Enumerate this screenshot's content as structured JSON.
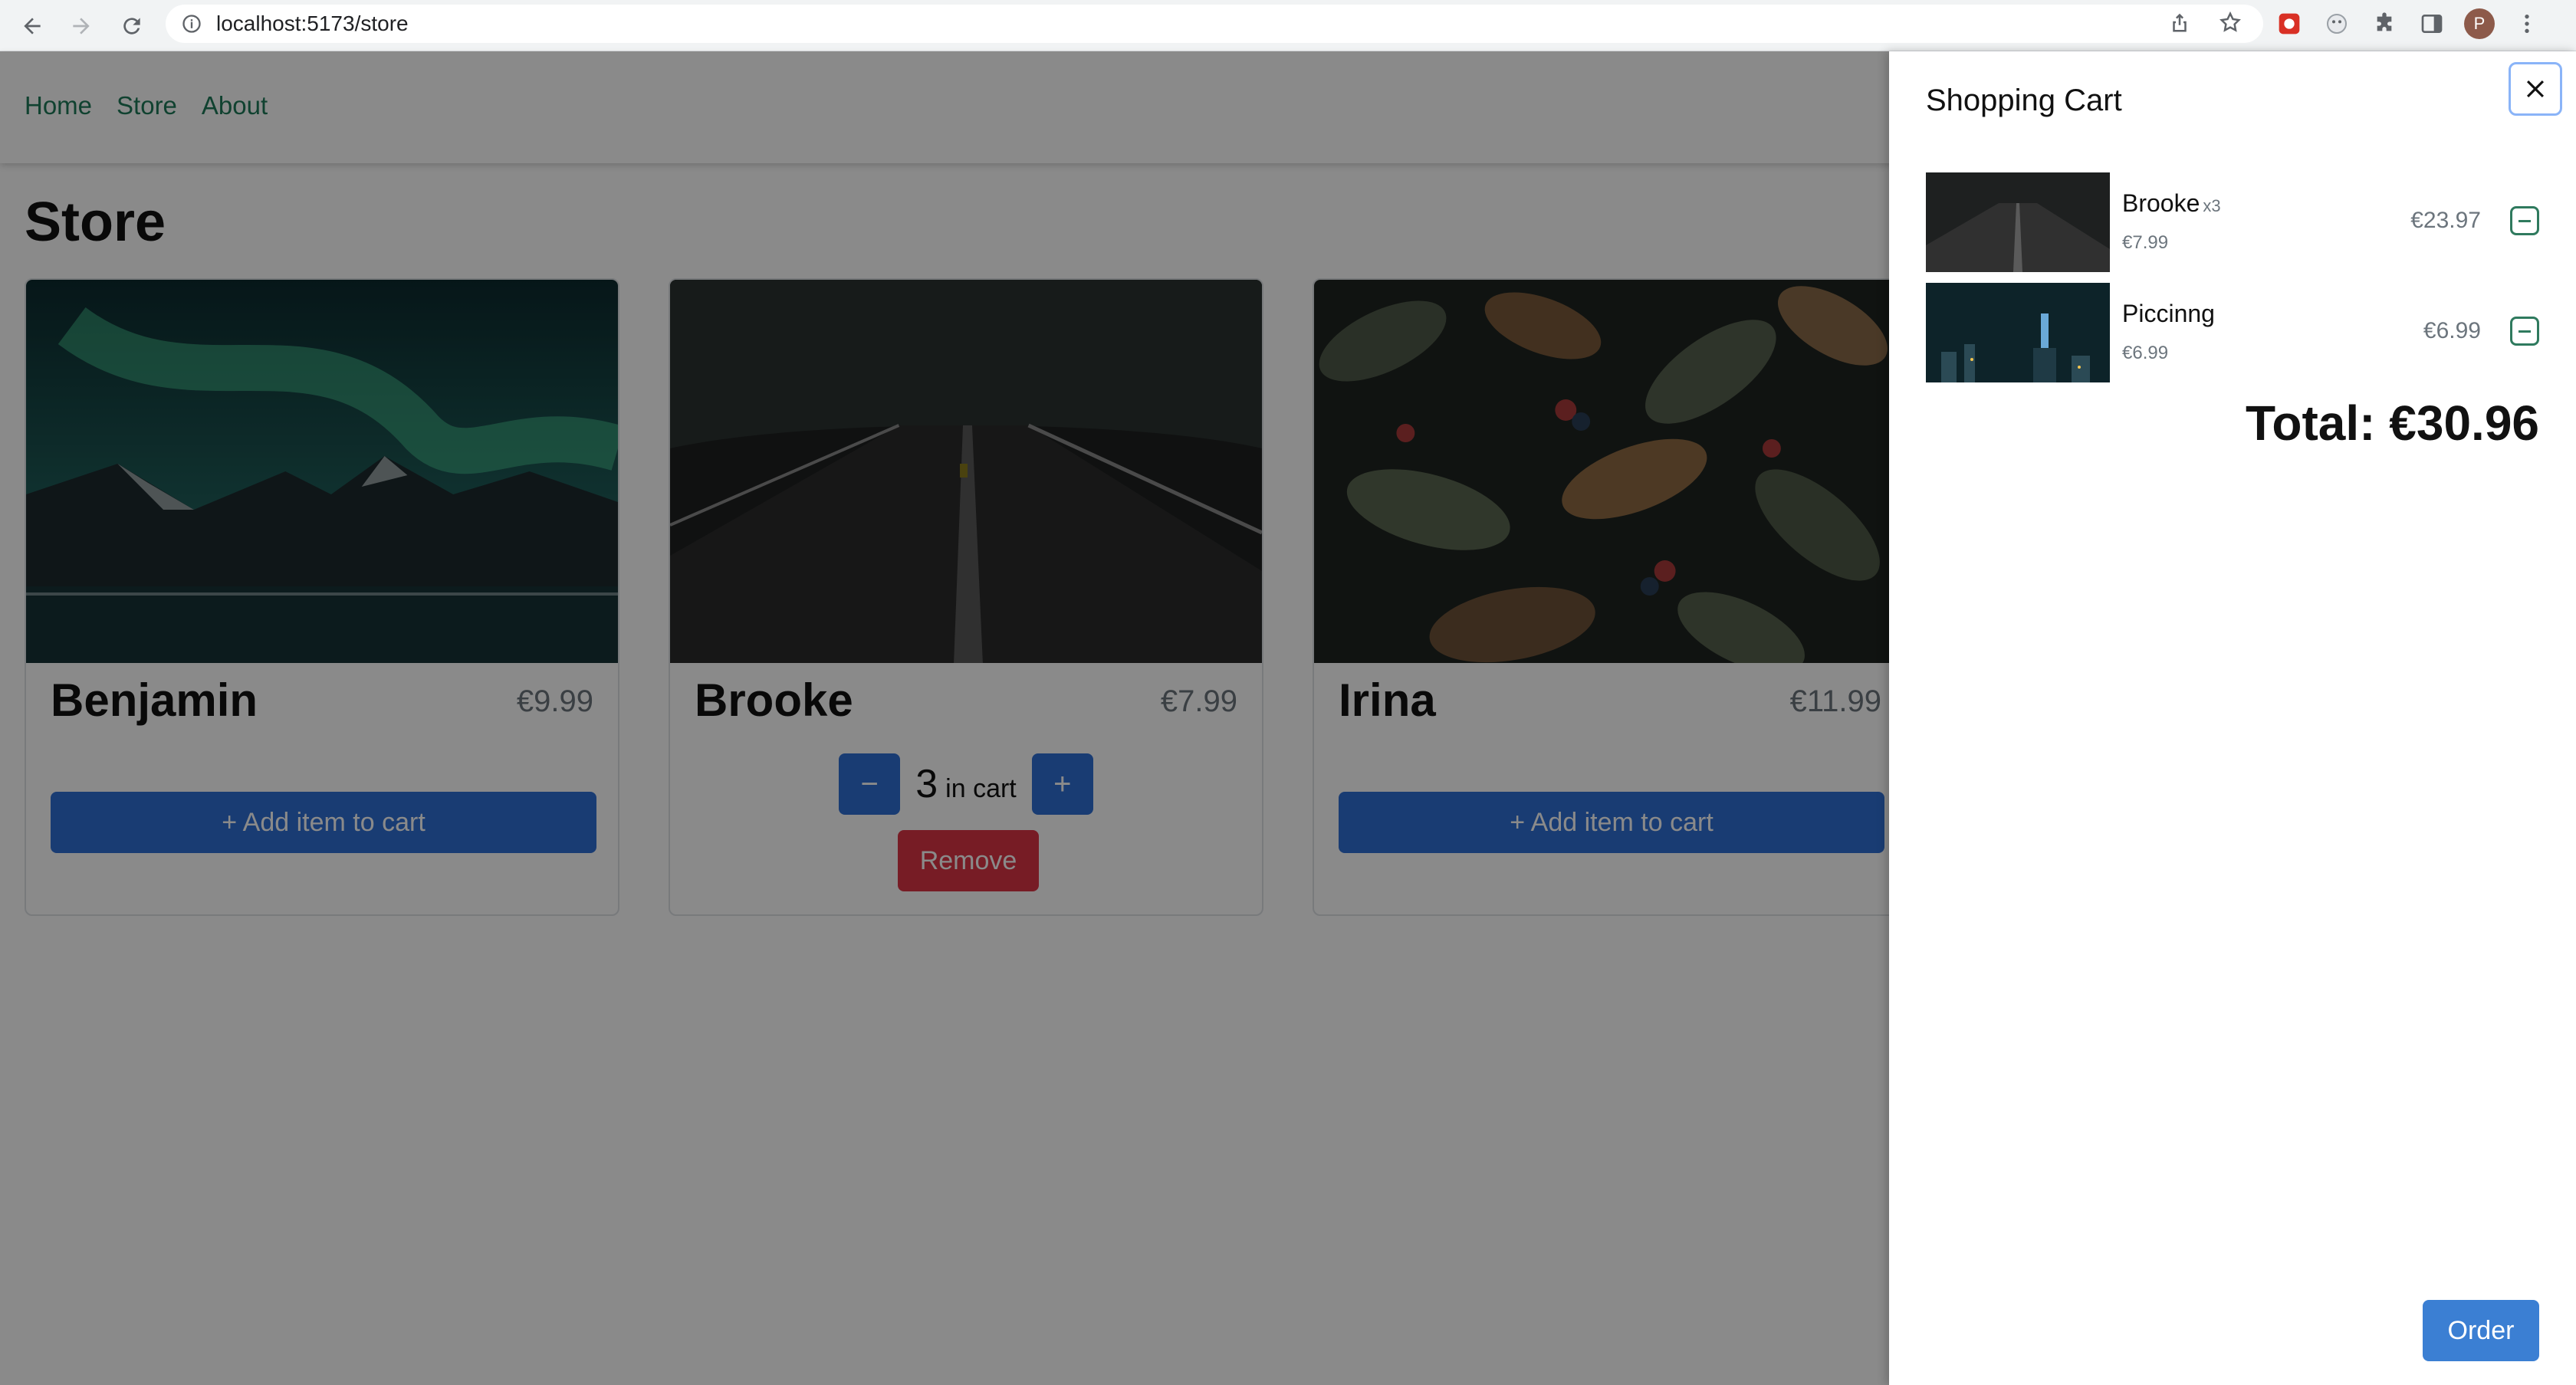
{
  "browser": {
    "url": "localhost:5173/store",
    "profile_initial": "P",
    "icons": [
      "back-arrow-icon",
      "forward-arrow-icon",
      "reload-icon",
      "info-icon",
      "share-icon",
      "star-icon",
      "extension-icon",
      "puzzle-icon",
      "sidebar-icon",
      "kebab-menu-icon"
    ]
  },
  "nav": {
    "links": [
      "Home",
      "Store",
      "About"
    ]
  },
  "store": {
    "title": "Store",
    "products": [
      {
        "name": "Benjamin",
        "price": "€9.99",
        "action": "+ Add item to cart"
      },
      {
        "name": "Brooke",
        "price": "€7.99",
        "quantity": "3",
        "quantity_suffix": "in cart",
        "minus": "−",
        "plus": "+",
        "remove": "Remove"
      },
      {
        "name": "Irina",
        "price": "€11.99",
        "action": "+ Add item to cart"
      }
    ]
  },
  "cart": {
    "title": "Shopping Cart",
    "items": [
      {
        "name": "Brooke",
        "qty": "x3",
        "unit_price": "€7.99",
        "total": "€23.97"
      },
      {
        "name": "Piccinng",
        "unit_price": "€6.99",
        "total": "€6.99"
      }
    ],
    "total": "Total: €30.96",
    "order_label": "Order"
  },
  "colors": {
    "link": "#1f7a5a",
    "primary": "#2f6fd4",
    "danger": "#dc3545",
    "overlay": "rgba(0,0,0,0.46)"
  }
}
